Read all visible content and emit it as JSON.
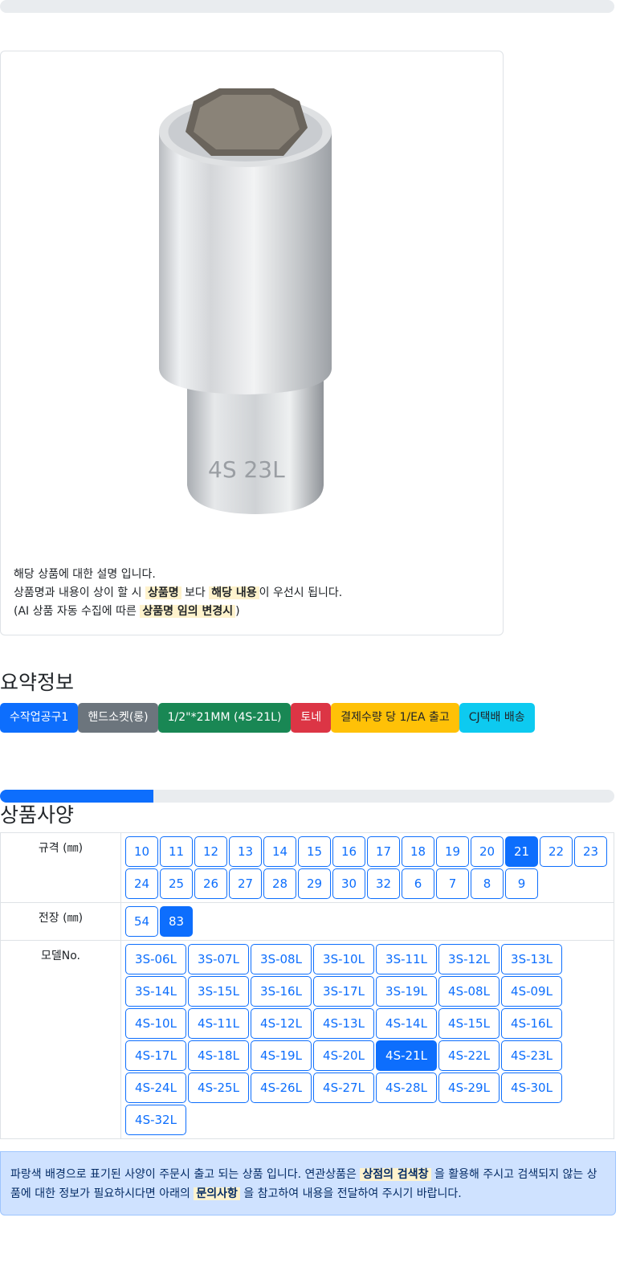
{
  "description": {
    "line1": "해당 상품에 대한 설명 입니다.",
    "line2_a": "상품명과 내용이 상이 할 시",
    "line2_hl1": "상품명",
    "line2_b": "보다",
    "line2_hl2": "해당 내용",
    "line2_c": "이 우선시 됩니다.",
    "line3_a": "(AI 상품 자동 수집에 따른",
    "line3_hl": "상품명 임의 변경시",
    "line3_b": ")"
  },
  "product_image": {
    "engraving": "4S 23L"
  },
  "summary": {
    "title": "요약정보",
    "tags": [
      {
        "label": "수작업공구1",
        "color": "#0d6efd"
      },
      {
        "label": "핸드소켓(롱)",
        "color": "#6c757d"
      },
      {
        "label": "1/2\"*21MM (4S-21L)",
        "color": "#198754"
      },
      {
        "label": "토네",
        "color": "#dc3545"
      },
      {
        "label": "결제수량 당 1/EA 출고",
        "color": "#ffc107",
        "text_color": "#212529"
      },
      {
        "label": "CJ택배 배송",
        "color": "#0dcaf0",
        "text_color": "#212529"
      }
    ]
  },
  "progress": {
    "fraction": 0.25
  },
  "spec": {
    "title": "상품사양",
    "rows": [
      {
        "label": "규격 (㎜)",
        "options": [
          "10",
          "11",
          "12",
          "13",
          "14",
          "15",
          "16",
          "17",
          "18",
          "19",
          "20",
          "21",
          "22",
          "23",
          "24",
          "25",
          "26",
          "27",
          "28",
          "29",
          "30",
          "32",
          "6",
          "7",
          "8",
          "9"
        ],
        "selected": "21"
      },
      {
        "label": "전장 (㎜)",
        "options": [
          "54",
          "83"
        ],
        "selected": "83"
      },
      {
        "label": "모델No.",
        "options": [
          "3S-06L",
          "3S-07L",
          "3S-08L",
          "3S-10L",
          "3S-11L",
          "3S-12L",
          "3S-13L",
          "3S-14L",
          "3S-15L",
          "3S-16L",
          "3S-17L",
          "3S-19L",
          "4S-08L",
          "4S-09L",
          "4S-10L",
          "4S-11L",
          "4S-12L",
          "4S-13L",
          "4S-14L",
          "4S-15L",
          "4S-16L",
          "4S-17L",
          "4S-18L",
          "4S-19L",
          "4S-20L",
          "4S-21L",
          "4S-22L",
          "4S-23L",
          "4S-24L",
          "4S-25L",
          "4S-26L",
          "4S-27L",
          "4S-28L",
          "4S-29L",
          "4S-30L",
          "4S-32L"
        ],
        "selected": "4S-21L"
      }
    ]
  },
  "notice": {
    "text_a": "파랑색 배경으로 표기된 사양이 주문시 출고 되는 상품 입니다. 연관상품은",
    "hl1": "상점의 검색창",
    "text_b": "을 활용해 주시고 검색되지 않는 상품에 대한 정보가 필요하시다면 아래의",
    "hl2": "문의사항",
    "text_c": "을 참고하여 내용을 전달하여 주시기 바랍니다."
  },
  "colors": {
    "accent": "#0d6efd",
    "highlight": "#fff3cd",
    "notice_bg": "#cfe2ff"
  }
}
